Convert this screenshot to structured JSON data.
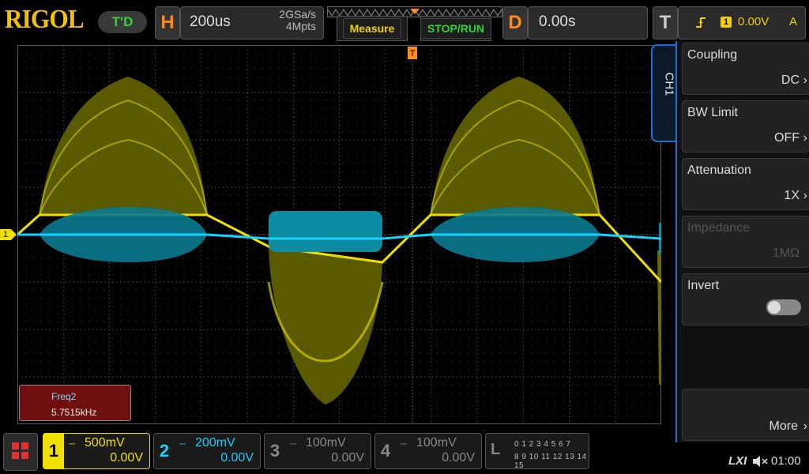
{
  "header": {
    "brand": "RIGOL",
    "mode_badge": "T'D",
    "horizontal": {
      "letter": "H",
      "timebase": "200us",
      "sample_rate": "2GSa/s",
      "memory_depth": "4Mpts"
    },
    "buttons": {
      "measure": "Measure",
      "stop_run": "STOP/RUN"
    },
    "delay": {
      "letter": "D",
      "value": "0.00s"
    },
    "trigger": {
      "letter": "T",
      "level": "0.00V",
      "source_num": "1",
      "mode": "A"
    }
  },
  "side_menu": {
    "channel_tab": "CH1",
    "items": [
      {
        "title": "Coupling",
        "value": "DC"
      },
      {
        "title": "BW Limit",
        "value": "OFF"
      },
      {
        "title": "Attenuation",
        "value": "1X"
      },
      {
        "title": "Impedance",
        "value": "1MΩ"
      },
      {
        "title": "Invert",
        "value": ""
      },
      {
        "title": "",
        "value": "More"
      }
    ]
  },
  "measurement": {
    "label": "Freq2",
    "value": "5.7515kHz"
  },
  "channels": [
    {
      "num": "1",
      "scale": "500mV",
      "offset": "0.00V",
      "color": "#f0e000"
    },
    {
      "num": "2",
      "scale": "200mV",
      "offset": "0.00V",
      "color": "#19d0ff"
    },
    {
      "num": "3",
      "scale": "100mV",
      "offset": "0.00V",
      "color": "#888888"
    },
    {
      "num": "4",
      "scale": "100mV",
      "offset": "0.00V",
      "color": "#888888"
    }
  ],
  "logic": {
    "letter": "L",
    "row1": "0 1 2 3  4 5 6 7",
    "row2": "8 9 10 11 12 13 14 15"
  },
  "status": {
    "lxi": "LXI",
    "time": "01:00"
  },
  "ch1_marker": "1",
  "colors": {
    "accent": "#1f6fd0",
    "ch1": "#f0e000",
    "ch2": "#19d0ff",
    "horizontal": "#ff8a1e"
  }
}
